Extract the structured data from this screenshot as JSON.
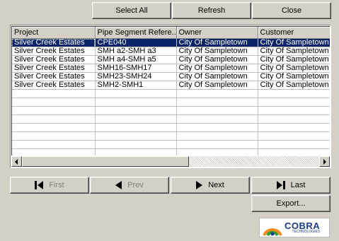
{
  "toolbar": {
    "select_all": "Select All",
    "refresh": "Refresh",
    "close": "Close"
  },
  "grid": {
    "columns": [
      "Project",
      "Pipe Segment Refere...",
      "Owner",
      "Customer"
    ],
    "rows": [
      [
        "Silver Creek Estates",
        "CPE040",
        "City Of Sampletown",
        "City Of Sampletown"
      ],
      [
        "Silver Creek Estates",
        "SMH a2-SMH a3",
        "City Of Sampletown",
        "City Of Sampletown"
      ],
      [
        "Silver Creek Estates",
        "SMH a4-SMH a5",
        "City Of Sampletown",
        "City Of Sampletown"
      ],
      [
        "Silver Creek Estates",
        "SMH16-SMH17",
        "City Of Sampletown",
        "City Of Sampletown"
      ],
      [
        "Silver Creek Estates",
        "SMH23-SMH24",
        "City Of Sampletown",
        "City Of Sampletown"
      ],
      [
        "Silver Creek Estates",
        "SMH2-SMH1",
        "City Of Sampletown",
        "City Of Sampletown"
      ]
    ],
    "empty_rows": 9,
    "selected_row": 0
  },
  "nav": {
    "first": "First",
    "prev": "Prev",
    "next": "Next",
    "last": "Last",
    "first_enabled": false,
    "prev_enabled": false
  },
  "export": "Export...",
  "logo": {
    "brand": "COBRA",
    "sub": "TECHNOLOGIES",
    "colors": {
      "green": "#2e9a36",
      "orange": "#f08c1c",
      "blue": "#1a3c8a"
    }
  },
  "icons": {
    "first": "skip-first-icon",
    "prev": "triangle-left-icon",
    "next": "triangle-right-icon",
    "last": "skip-last-icon",
    "scroll_left": "scroll-left-arrow-icon",
    "scroll_right": "scroll-right-arrow-icon"
  }
}
